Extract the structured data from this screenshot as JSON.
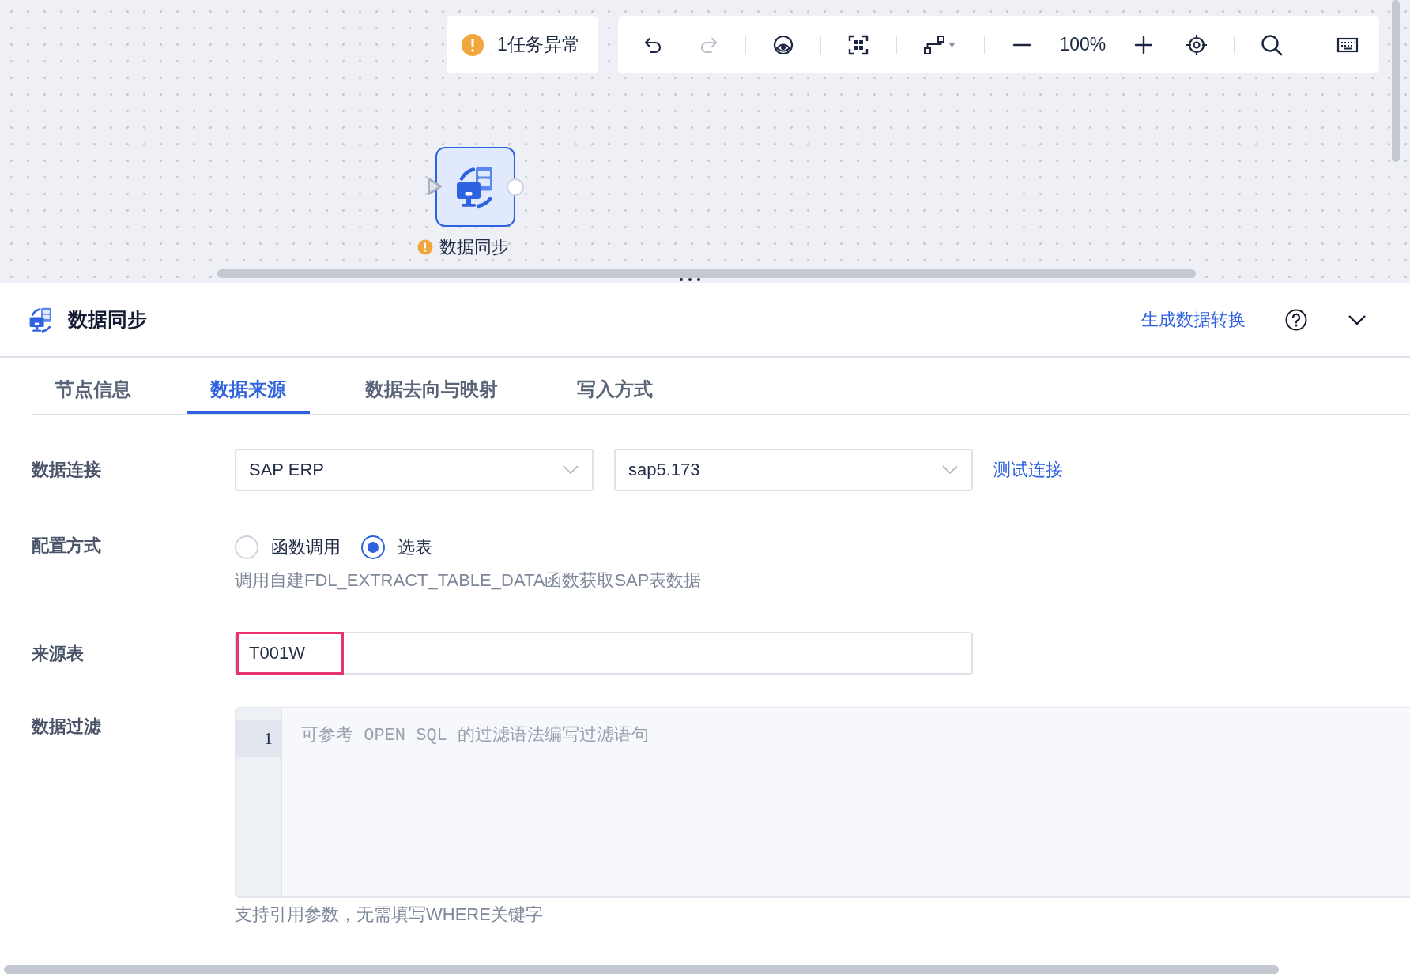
{
  "alert": {
    "text": "1任务异常"
  },
  "toolbar": {
    "items": [
      {
        "kind": "undo",
        "disabled": false
      },
      {
        "kind": "redo",
        "disabled": true
      },
      {
        "kind": "divider"
      },
      {
        "kind": "preview",
        "disabled": false
      },
      {
        "kind": "divider"
      },
      {
        "kind": "fit",
        "disabled": false
      },
      {
        "kind": "divider"
      },
      {
        "kind": "layout",
        "disabled": false
      },
      {
        "kind": "divider"
      },
      {
        "kind": "zoom-out",
        "disabled": false
      },
      {
        "kind": "zoom-level",
        "text": "100%"
      },
      {
        "kind": "zoom-in",
        "disabled": false
      },
      {
        "kind": "locate",
        "disabled": false
      },
      {
        "kind": "divider"
      },
      {
        "kind": "search",
        "disabled": false
      },
      {
        "kind": "divider"
      },
      {
        "kind": "keyboard",
        "disabled": false
      }
    ]
  },
  "node": {
    "label": "数据同步",
    "warning": true,
    "selected": true
  },
  "panel": {
    "title": "数据同步",
    "link": "生成数据转换"
  },
  "tabs": [
    {
      "label": "节点信息",
      "selected": false
    },
    {
      "label": "数据来源",
      "selected": true
    },
    {
      "label": "数据去向与映射",
      "selected": false
    },
    {
      "label": "写入方式",
      "selected": false
    }
  ],
  "form": {
    "connection": {
      "label": "数据连接",
      "selects": [
        {
          "value": "SAP ERP"
        },
        {
          "value": "sap5.173"
        }
      ],
      "link": "测试连接"
    },
    "config": {
      "label": "配置方式",
      "options": [
        {
          "label": "函数调用",
          "selected": false
        },
        {
          "label": "选表",
          "selected": true
        }
      ],
      "hint": "调用自建FDL_EXTRACT_TABLE_DATA函数获取SAP表数据"
    },
    "source": {
      "label": "来源表",
      "value": "T001W",
      "highlighted": true
    },
    "filter": {
      "label": "数据过滤",
      "line_numbers": [
        "1"
      ],
      "placeholder": "可参考 OPEN SQL 的过滤语法编写过滤语句",
      "hint": "支持引用参数，无需填写WHERE关键字"
    }
  }
}
